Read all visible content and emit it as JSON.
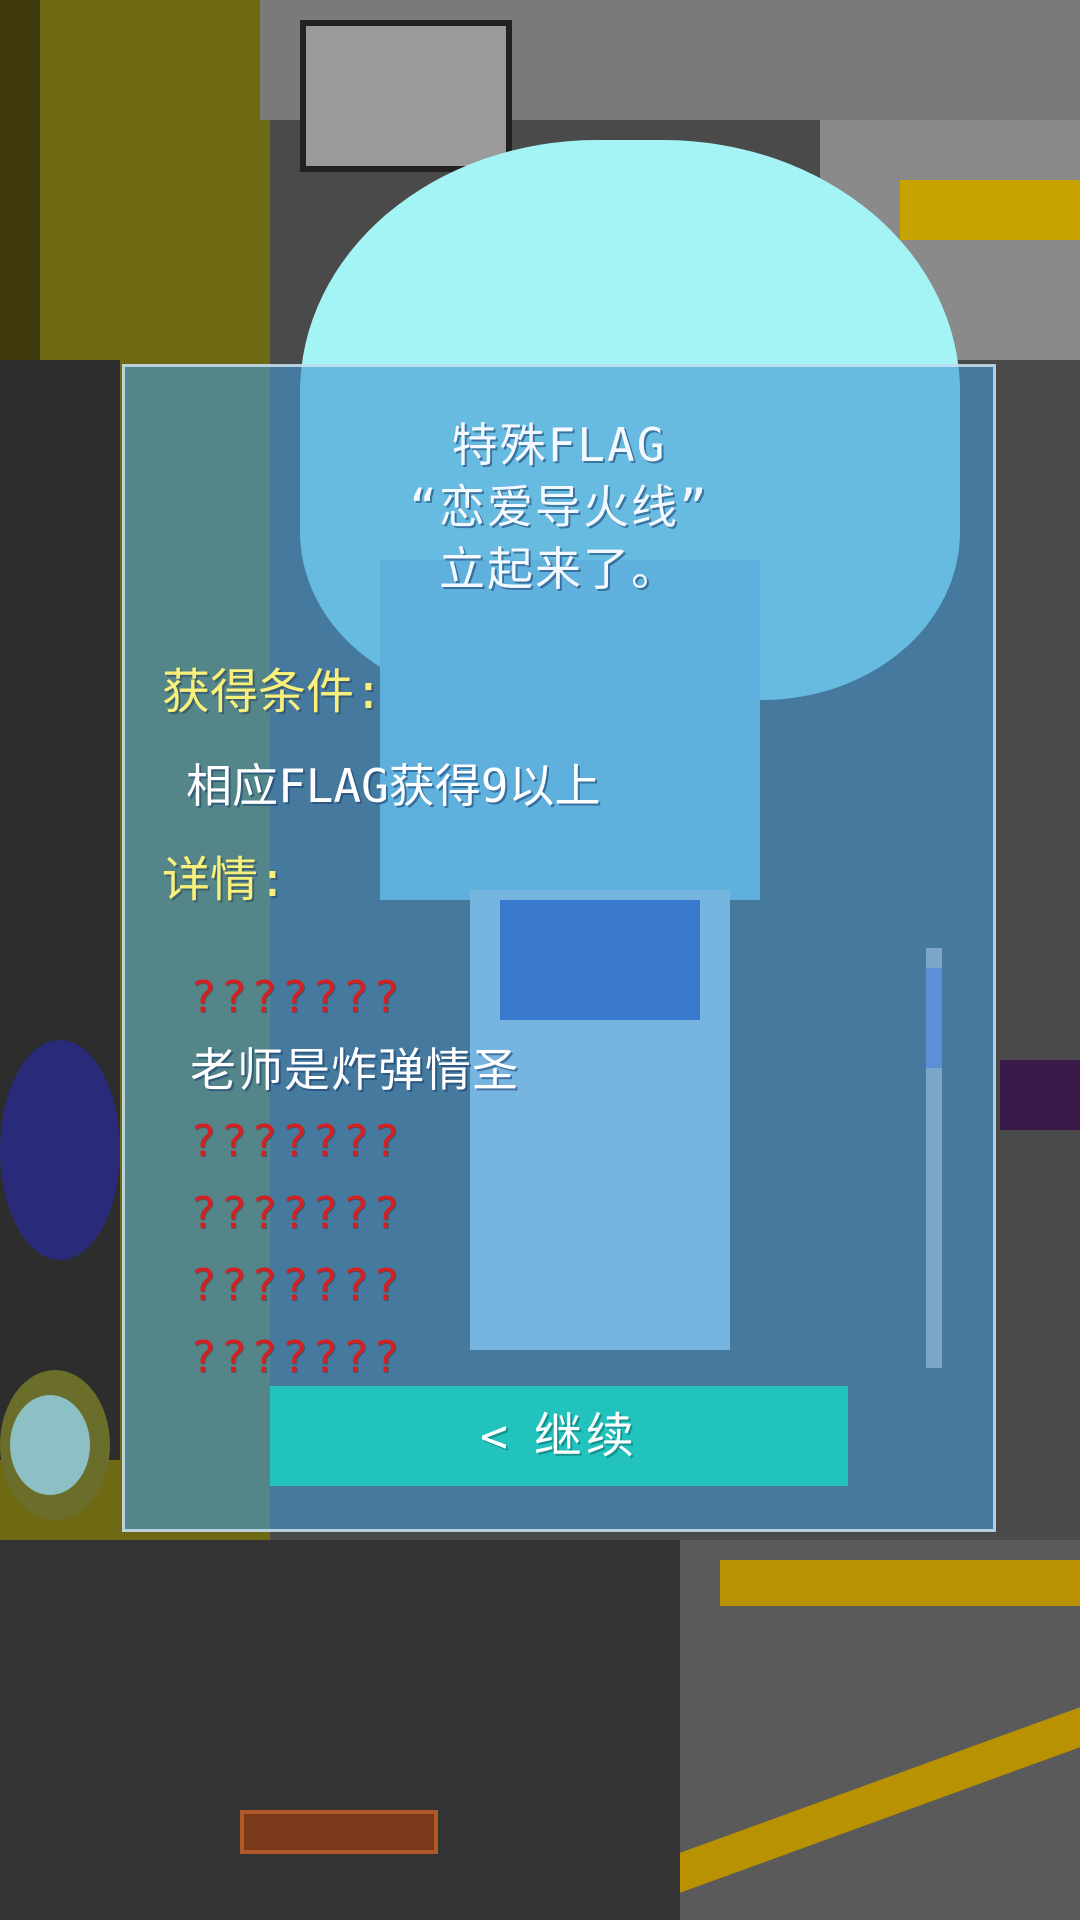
{
  "dialog": {
    "title_lines": [
      "特殊FLAG",
      "“恋爱导火线”",
      "立起来了。"
    ],
    "condition_label": "获得条件:",
    "condition_text": "相应FLAG获得9以上",
    "details_label": "详情:",
    "details": [
      {
        "text": "???????",
        "unlocked": false
      },
      {
        "text": "老师是炸弹情圣",
        "unlocked": true
      },
      {
        "text": "???????",
        "unlocked": false
      },
      {
        "text": "???????",
        "unlocked": false
      },
      {
        "text": "???????",
        "unlocked": false
      },
      {
        "text": "???????",
        "unlocked": false
      }
    ],
    "continue_label": "继续",
    "continue_icon": "chevron-left-icon"
  },
  "colors": {
    "label": "#f8f07a",
    "locked": "#d42020",
    "button": "#22c2bd"
  }
}
